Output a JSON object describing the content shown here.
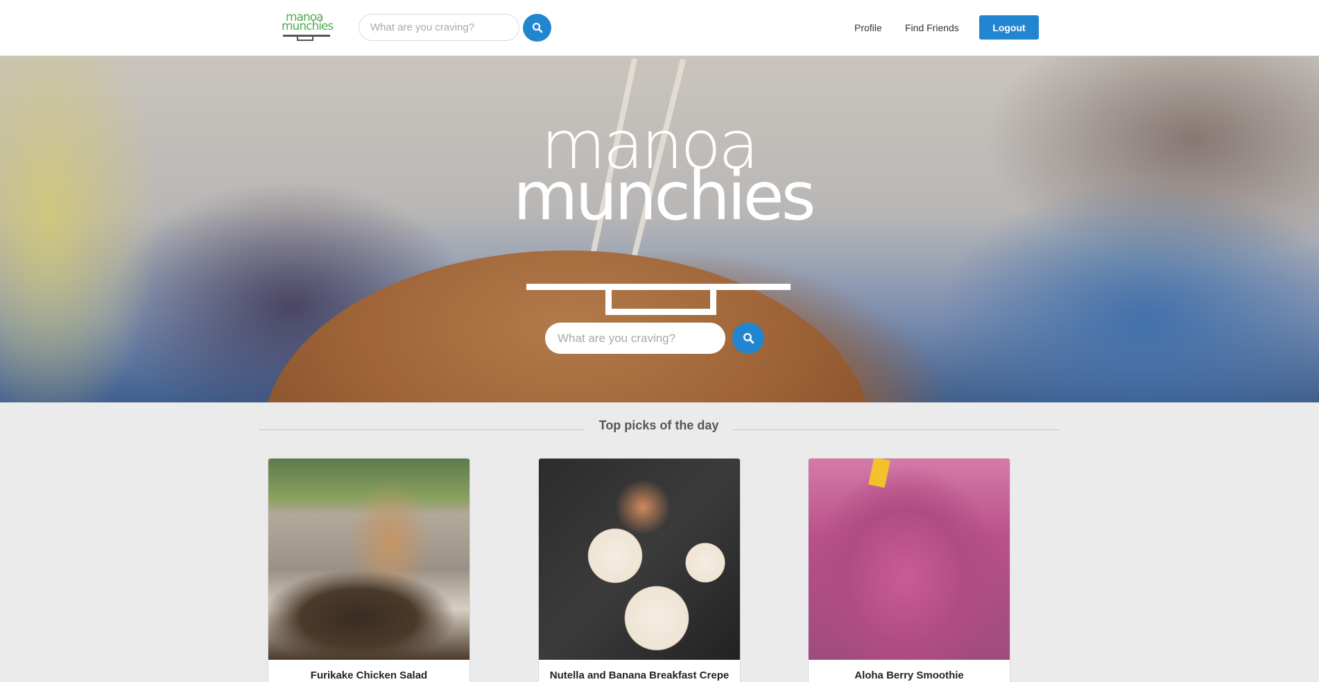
{
  "brand": {
    "logo_line1": "manoa",
    "logo_line2": "munchies"
  },
  "nav": {
    "search_placeholder": "What are you craving?",
    "links": {
      "profile": "Profile",
      "find_friends": "Find Friends"
    },
    "logout_label": "Logout"
  },
  "hero": {
    "logo_line1": "manoa",
    "logo_line2": "munchies",
    "search_placeholder": "What are you craving?"
  },
  "top_picks": {
    "title": "Top picks of the day",
    "items": [
      {
        "name": "Furikake Chicken Salad"
      },
      {
        "name": "Nutella and Banana Breakfast Crepe"
      },
      {
        "name": "Aloha Berry Smoothie"
      }
    ]
  },
  "colors": {
    "primary": "#2185d0",
    "brand_green": "#4caf50",
    "page_bg": "#ebebeb"
  },
  "icons": {
    "search": "search-icon"
  }
}
